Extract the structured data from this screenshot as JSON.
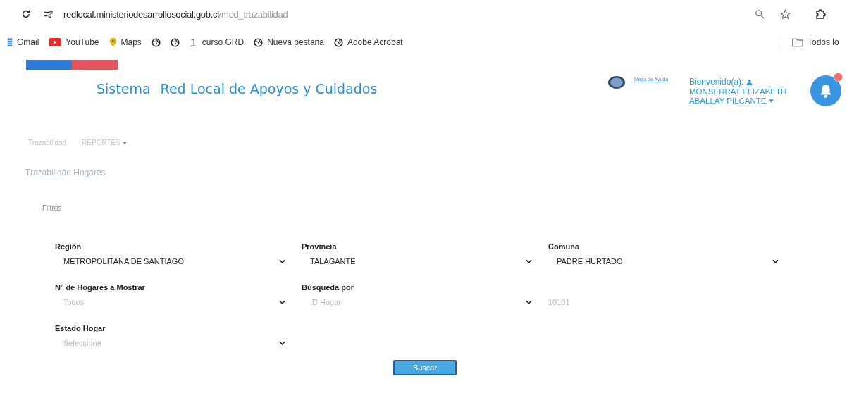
{
  "browser": {
    "url_host": "redlocal.ministeriodesarrollosocial.gob.cl",
    "url_path": "/mod_trazabilidad",
    "bookmarks": [
      {
        "kind": "gmail",
        "label": "Gmail"
      },
      {
        "kind": "youtube",
        "label": "YouTube"
      },
      {
        "kind": "maps",
        "label": "Maps"
      },
      {
        "kind": "globe"
      },
      {
        "kind": "globe"
      },
      {
        "kind": "doc",
        "label": "curso GRD"
      },
      {
        "kind": "globe",
        "label": "Nueva pestaña"
      },
      {
        "kind": "globe",
        "label": "Adobe Acrobat"
      }
    ],
    "other_bookmarks": "Todos lo"
  },
  "header": {
    "system": "Sistema",
    "title": "Red Local de Apoyos y Cuidados",
    "help_link": "Mesa de Ayuda",
    "welcome": "Bienvenido(a):",
    "user_name": "MONSERRAT ELIZABETH ABALLAY PILCANTE",
    "notifications": true
  },
  "nav": [
    {
      "label": "Trazabilidad",
      "dropdown": false
    },
    {
      "label": "REPORTES",
      "dropdown": true
    }
  ],
  "page_title": "Trazabilidad Hogares",
  "section": "Filtros",
  "fields": [
    {
      "kind": "select",
      "label": "Región",
      "value": "METROPOLITANA DE SANTIAGO"
    },
    {
      "kind": "select",
      "label": "Provincia",
      "value": "TALAGANTE"
    },
    {
      "kind": "select",
      "label": "Comuna",
      "value": "PADRE HURTADO"
    },
    {
      "kind": "select",
      "label": "N° de Hogares a Mostrar",
      "placeholder": "Todos"
    },
    {
      "kind": "select",
      "label": "Búsqueda por",
      "placeholder": "ID Hogar"
    },
    {
      "kind": "text",
      "placeholder": "10101"
    },
    {
      "kind": "select",
      "label": "Estado Hogar",
      "placeholder": "Seleccione"
    }
  ],
  "submit": "Buscar"
}
